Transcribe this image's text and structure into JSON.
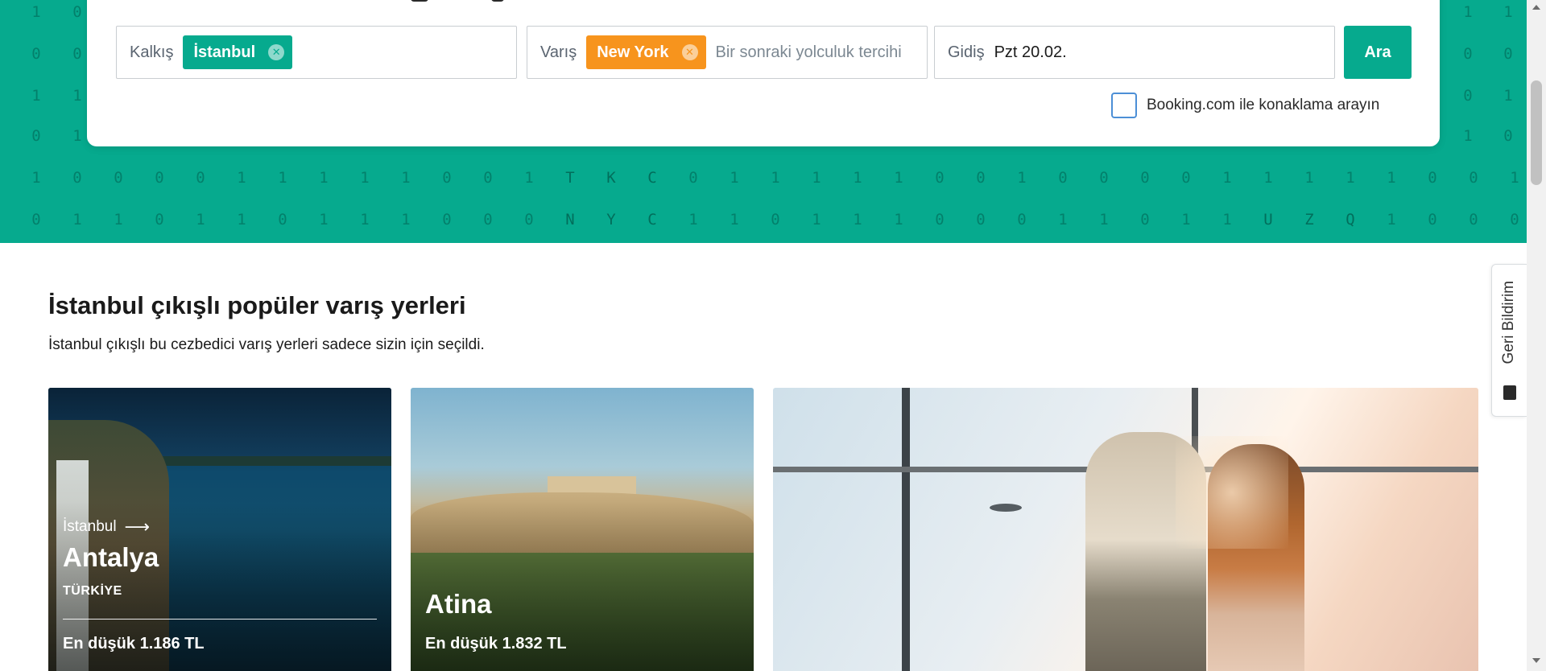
{
  "search": {
    "origin_label": "Kalkış",
    "origin_chip": "İstanbul",
    "destination_label": "Varış",
    "destination_chip": "New York",
    "destination_placeholder": "Bir sonraki yolculuk tercihi",
    "date_label": "Gidiş",
    "date_value": "Pzt 20.02.",
    "search_button": "Ara",
    "booking_checkbox_label": "Booking.com ile konaklama arayın",
    "booking_checked": false
  },
  "hero_binary": {
    "rows": [
      [
        "1",
        "0",
        "",
        "",
        "",
        "",
        "",
        "",
        "",
        "",
        "",
        "",
        "",
        "",
        "",
        "",
        "",
        "",
        "",
        "",
        "",
        "",
        "",
        "",
        "",
        "",
        "",
        "",
        "",
        "",
        "",
        "",
        "",
        "",
        "",
        "",
        "1",
        "1"
      ],
      [
        "0",
        "0",
        "",
        "",
        "",
        "",
        "",
        "",
        "",
        "",
        "",
        "",
        "",
        "",
        "",
        "",
        "",
        "",
        "",
        "",
        "",
        "",
        "",
        "",
        "",
        "",
        "",
        "",
        "",
        "",
        "",
        "",
        "",
        "",
        "",
        "",
        "0",
        "0"
      ],
      [
        "1",
        "1",
        "",
        "",
        "",
        "",
        "",
        "",
        "",
        "",
        "",
        "",
        "",
        "",
        "",
        "",
        "",
        "",
        "",
        "",
        "",
        "",
        "",
        "",
        "",
        "",
        "",
        "",
        "",
        "",
        "",
        "",
        "",
        "",
        "",
        "",
        "0",
        "1"
      ],
      [
        "0",
        "1",
        "",
        "",
        "",
        "",
        "",
        "",
        "",
        "",
        "",
        "",
        "",
        "",
        "",
        "",
        "",
        "",
        "",
        "",
        "",
        "",
        "",
        "",
        "",
        "",
        "",
        "",
        "",
        "",
        "",
        "",
        "",
        "",
        "",
        "",
        "1",
        "0"
      ],
      [
        "1",
        "0",
        "0",
        "0",
        "0",
        "1",
        "1",
        "1",
        "1",
        "1",
        "0",
        "0",
        "1",
        "T",
        "K",
        "C",
        "0",
        "1",
        "1",
        "1",
        "1",
        "1",
        "0",
        "0",
        "1",
        "0",
        "0",
        "0",
        "0",
        "1",
        "1",
        "1",
        "1",
        "1",
        "0",
        "0",
        "1"
      ],
      [
        "0",
        "1",
        "1",
        "0",
        "1",
        "1",
        "0",
        "1",
        "1",
        "1",
        "0",
        "0",
        "0",
        "N",
        "Y",
        "C",
        "1",
        "1",
        "0",
        "1",
        "1",
        "1",
        "0",
        "0",
        "0",
        "1",
        "1",
        "0",
        "1",
        "1",
        "U",
        "Z",
        "Q",
        "1",
        "0",
        "0",
        "0"
      ]
    ]
  },
  "main": {
    "title": "İstanbul çıkışlı popüler varış yerleri",
    "subtitle": "İstanbul çıkışlı bu cezbedici varış yerleri sadece sizin için seçildi."
  },
  "cards": {
    "antalya": {
      "from": "İstanbul",
      "arrow": "⟶",
      "city": "Antalya",
      "country": "TÜRKİYE",
      "price": "En düşük 1.186 TL"
    },
    "atina": {
      "city": "Atina",
      "price": "En düşük 1.832 TL"
    }
  },
  "feedback": {
    "label": "Geri Bildirim"
  },
  "colors": {
    "brand_green": "#06aa8e",
    "accent_orange": "#f7941d"
  }
}
